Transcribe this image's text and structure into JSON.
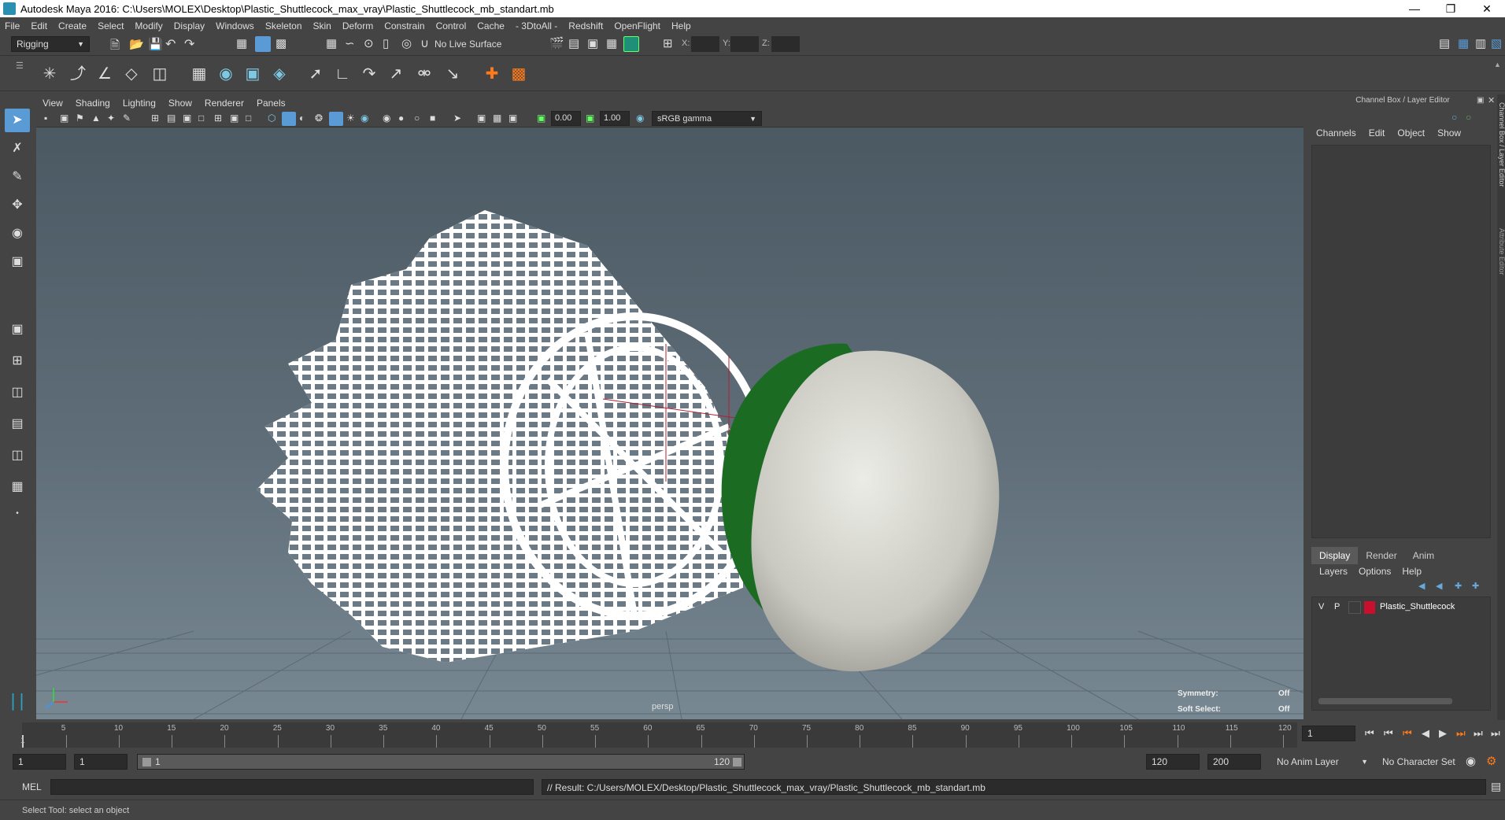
{
  "window": {
    "title": "Autodesk Maya 2016: C:\\Users\\MOLEX\\Desktop\\Plastic_Shuttlecock_max_vray\\Plastic_Shuttlecock_mb_standart.mb"
  },
  "menubar": [
    "File",
    "Edit",
    "Create",
    "Select",
    "Modify",
    "Display",
    "Windows",
    "Skeleton",
    "Skin",
    "Deform",
    "Constrain",
    "Control",
    "Cache",
    "- 3DtoAll -",
    "Redshift",
    "OpenFlight",
    "Help"
  ],
  "statusline": {
    "mode": "Rigging",
    "live_surface": "No Live Surface",
    "x_label": "X:",
    "y_label": "Y:",
    "z_label": "Z:"
  },
  "viewport": {
    "menu": [
      "View",
      "Shading",
      "Lighting",
      "Show",
      "Renderer",
      "Panels"
    ],
    "exposure": "0.00",
    "gamma": "1.00",
    "color_space": "sRGB gamma",
    "camera_label": "persp",
    "symmetry_label": "Symmetry:",
    "symmetry_value": "Off",
    "softselect_label": "Soft Select:",
    "softselect_value": "Off"
  },
  "rightpanel": {
    "header": "Channel Box / Layer Editor",
    "channel_menu": [
      "Channels",
      "Edit",
      "Object",
      "Show"
    ],
    "tabs": [
      "Display",
      "Render",
      "Anim"
    ],
    "layer_menu": [
      "Layers",
      "Options",
      "Help"
    ],
    "layer": {
      "v": "V",
      "p": "P",
      "name": "Plastic_Shuttlecock",
      "color": "#c8102e"
    },
    "side_tab_1": "Channel Box / Layer Editor",
    "side_tab_2": "Attribute Editor"
  },
  "timeline": {
    "ticks": [
      "5",
      "10",
      "15",
      "20",
      "25",
      "30",
      "35",
      "40",
      "45",
      "50",
      "55",
      "60",
      "65",
      "70",
      "75",
      "80",
      "85",
      "90",
      "95",
      "100",
      "105",
      "110",
      "115",
      "120"
    ],
    "current_frame": "1",
    "current_marker": "1"
  },
  "range": {
    "start": "1",
    "start2": "1",
    "slider_start": "1",
    "slider_end": "120",
    "end": "120",
    "end2": "200",
    "anim_layer": "No Anim Layer",
    "char_set": "No Character Set"
  },
  "cmdline": {
    "lang": "MEL",
    "result": "// Result: C:/Users/MOLEX/Desktop/Plastic_Shuttlecock_max_vray/Plastic_Shuttlecock_mb_standart.mb"
  },
  "helpline": {
    "text": "Select Tool: select an object"
  },
  "colors": {
    "accent": "#5a9bd5",
    "cork_band": "#1c6b23",
    "cork": "#d8d8d0"
  }
}
